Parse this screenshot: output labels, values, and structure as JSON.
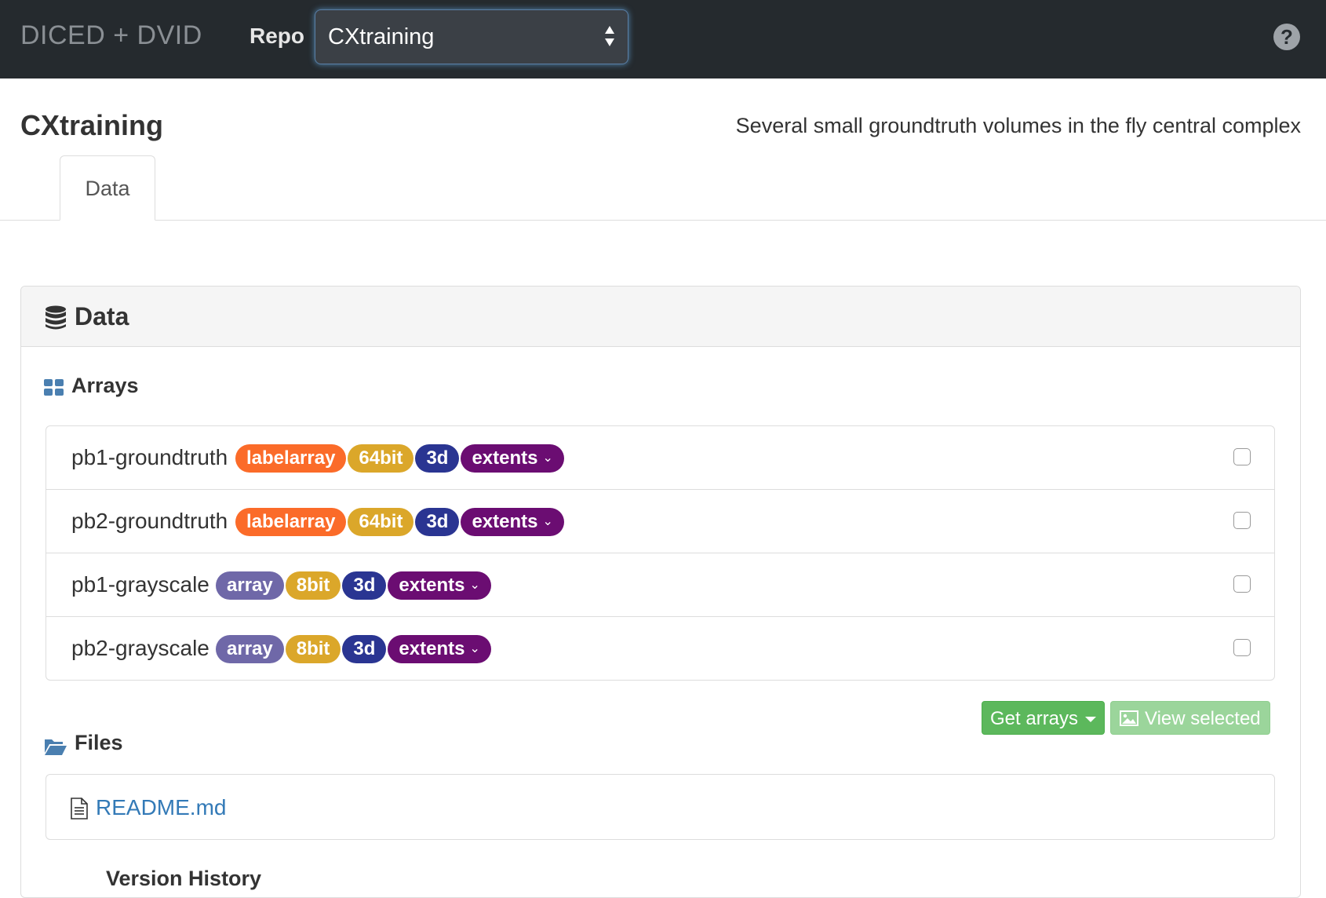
{
  "navbar": {
    "brand": "DICED + DVID",
    "repo_label": "Repo",
    "repo_select_value": "CXtraining",
    "help_icon": "question-circle-icon"
  },
  "page": {
    "title": "CXtraining",
    "description": "Several small groundtruth volumes in the fly central complex"
  },
  "tabs": [
    {
      "label": "Data"
    }
  ],
  "panel": {
    "title": "Data",
    "icon": "database-icon"
  },
  "arrays": {
    "heading": "Arrays",
    "icon": "grid-icon",
    "items": [
      {
        "name": "pb1-groundtruth",
        "tags": [
          "labelarray",
          "64bit",
          "3d",
          "extents"
        ]
      },
      {
        "name": "pb2-groundtruth",
        "tags": [
          "labelarray",
          "64bit",
          "3d",
          "extents"
        ]
      },
      {
        "name": "pb1-grayscale",
        "tags": [
          "array",
          "8bit",
          "3d",
          "extents"
        ]
      },
      {
        "name": "pb2-grayscale",
        "tags": [
          "array",
          "8bit",
          "3d",
          "extents"
        ]
      }
    ],
    "get_arrays_button": "Get arrays",
    "view_selected_button": "View selected"
  },
  "files": {
    "heading": "Files",
    "icon": "folder-open-icon",
    "items": [
      {
        "name": "README.md",
        "icon": "file-text-icon"
      }
    ]
  },
  "version_history": {
    "heading": "Version History"
  },
  "colors": {
    "navbar": "#252a2e",
    "labelarray": "#fb6b29",
    "array": "#6f68a8",
    "64bit": "#dba72a",
    "8bit": "#dba72a",
    "3d": "#2a3592",
    "extents": "#6b0d72",
    "success": "#5cb85c",
    "link": "#337ab7"
  }
}
